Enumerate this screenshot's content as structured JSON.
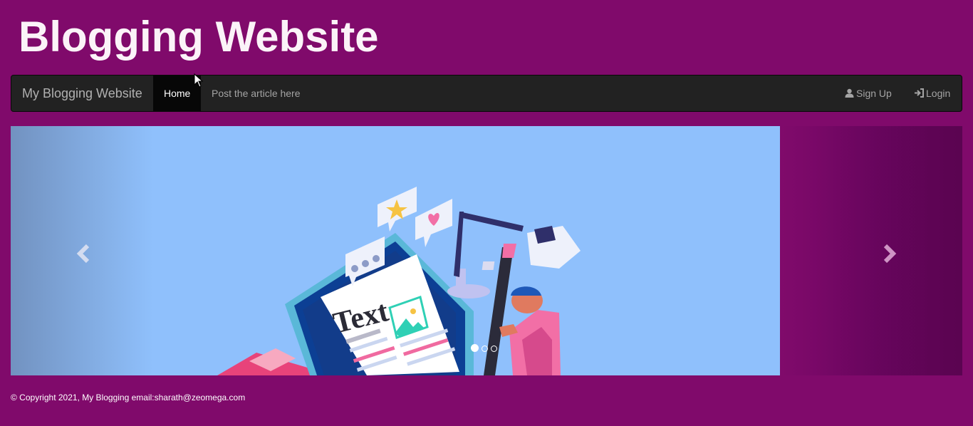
{
  "header": {
    "title": "Blogging Website"
  },
  "navbar": {
    "brand": "My Blogging Website",
    "items": [
      {
        "label": "Home",
        "active": true
      },
      {
        "label": "Post the article here",
        "active": false
      }
    ],
    "right_items": [
      {
        "label": "Sign Up",
        "icon": "user-icon"
      },
      {
        "label": "Login",
        "icon": "login-icon"
      }
    ]
  },
  "carousel": {
    "slide_text": "Text",
    "indicator_count": 3,
    "active_indicator": 1,
    "prev_icon": "chevron-left-icon",
    "next_icon": "chevron-right-icon"
  },
  "footer": {
    "text": "© Copyright 2021, My Blogging email:sharath@zeomega.com"
  },
  "colors": {
    "page_background": "#800a6b",
    "navbar_background": "#222222",
    "slide_background": "#8fc0fc"
  }
}
